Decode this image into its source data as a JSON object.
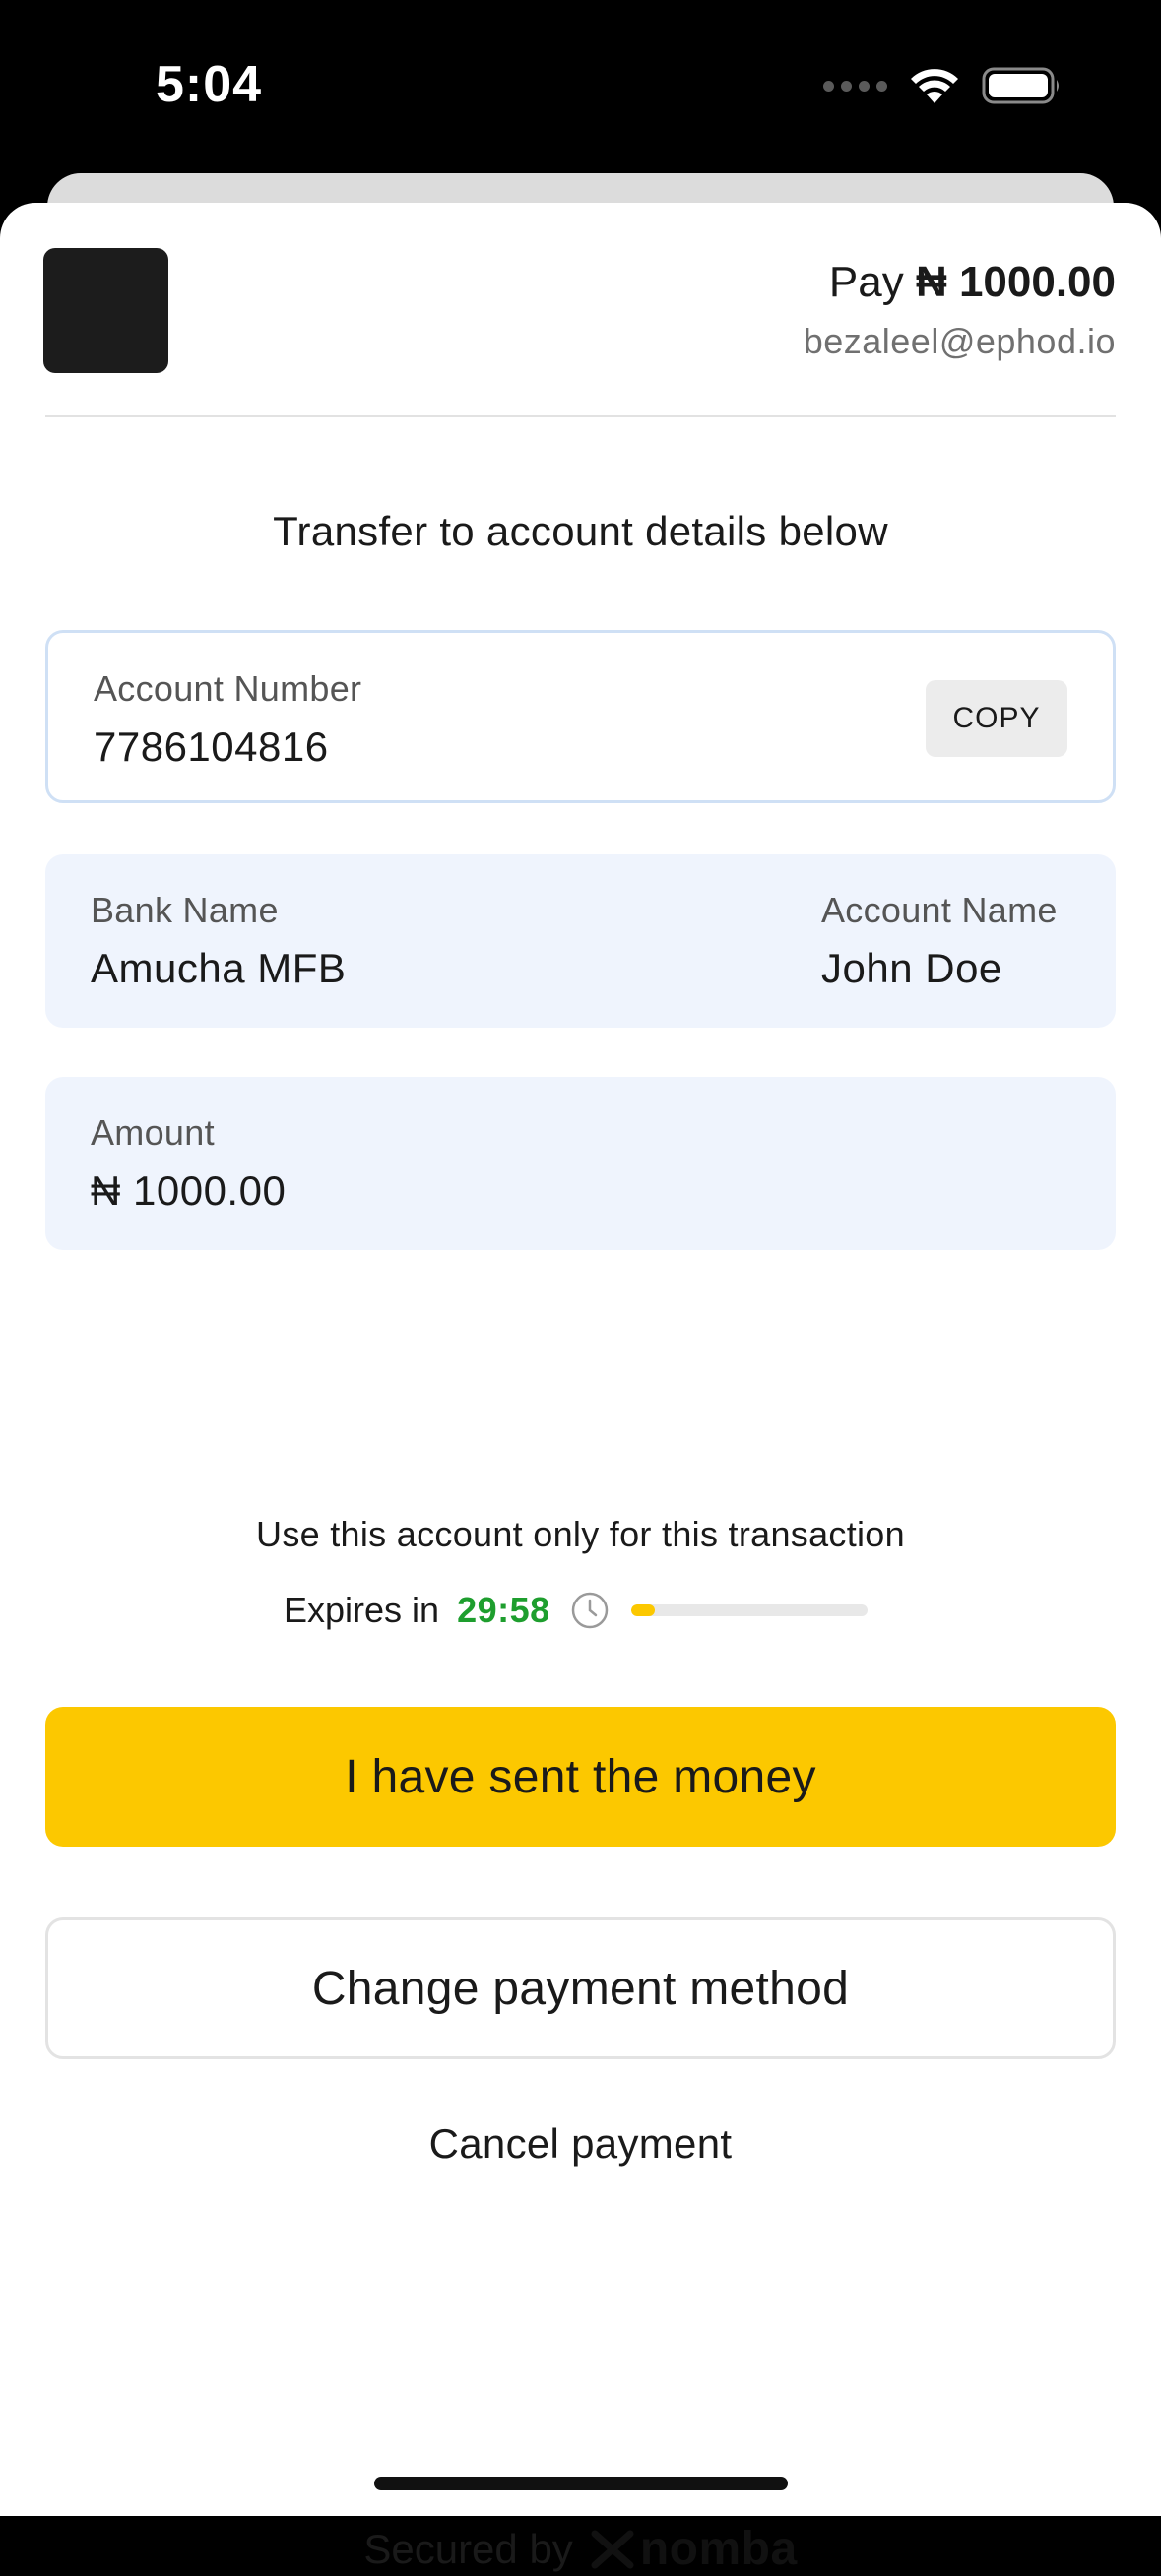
{
  "status_bar": {
    "time": "5:04",
    "icons": [
      "signal-dots-icon",
      "wifi-icon",
      "battery-icon"
    ]
  },
  "header": {
    "pay_prefix": "Pay",
    "amount": "₦ 1000.00",
    "email": "bezaleel@ephod.io"
  },
  "instruction": "Transfer to account details below",
  "account_number": {
    "label": "Account Number",
    "value": "7786104816",
    "copy_label": "COPY"
  },
  "bank": {
    "label": "Bank Name",
    "value": "Amucha MFB"
  },
  "account_name": {
    "label": "Account Name",
    "value": "John Doe"
  },
  "amount_card": {
    "label": "Amount",
    "value": "₦ 1000.00"
  },
  "note": "Use this account only for this transaction",
  "expiry": {
    "label": "Expires in",
    "time": "29:58",
    "progress_fraction": 0.1
  },
  "actions": {
    "primary": "I have sent the money",
    "secondary": "Change payment method",
    "cancel": "Cancel payment"
  },
  "footer": {
    "secured_by": "Secured by",
    "brand": "nomba"
  },
  "colors": {
    "accent": "#fcc800",
    "timer_green": "#1e9e2e",
    "card_fill": "#eff4fd",
    "card_border": "#cfe0f5"
  }
}
